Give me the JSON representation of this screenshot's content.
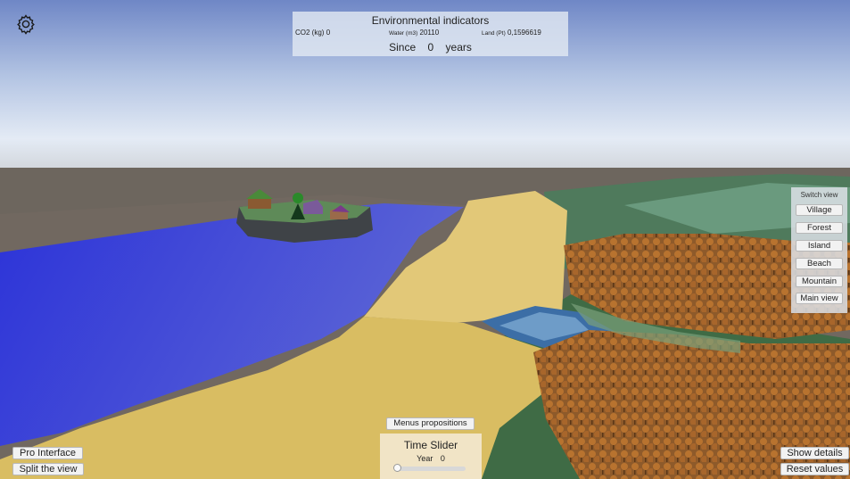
{
  "env": {
    "title": "Environmental indicators",
    "co2_label": "CO2 (kg)",
    "co2_value": "0",
    "water_label": "Water (m3)",
    "water_value": "20110",
    "land_label": "Land (Pt)",
    "land_value": "0,1596619",
    "since_label": "Since",
    "since_value": "0",
    "since_unit": "years"
  },
  "switch_view": {
    "title": "Switch view",
    "items": [
      "Village",
      "Forest",
      "Island",
      "Beach",
      "Mountain",
      "Main view"
    ]
  },
  "buttons": {
    "menus_propositions": "Menus propositions",
    "pro_interface": "Pro Interface",
    "split_view": "Split the view",
    "show_details": "Show details",
    "reset_values": "Reset values"
  },
  "time_slider": {
    "title": "Time Slider",
    "year_label": "Year",
    "year_value": "0",
    "position": 0
  },
  "icons": {
    "settings": "gear-icon"
  }
}
